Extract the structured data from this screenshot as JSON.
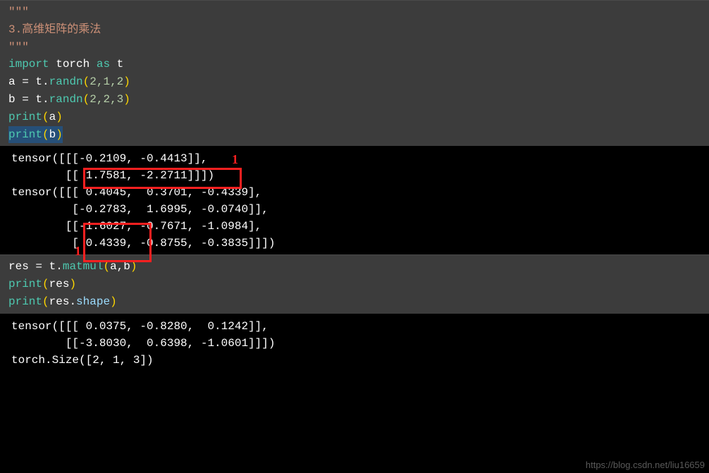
{
  "cell1": {
    "docstring_open": "\"\"\"",
    "comment": "3.高维矩阵的乘法",
    "docstring_close": "\"\"\"",
    "import_kw": "import",
    "import_module": "torch",
    "as_kw": "as",
    "import_alias": "t",
    "line5_var": "a",
    "line5_eq": " = ",
    "line5_obj": "t",
    "line5_dot": ".",
    "line5_fn": "randn",
    "line5_open": "(",
    "line5_args": "2,1,2",
    "line5_close": ")",
    "line6_var": "b",
    "line6_eq": " = ",
    "line6_obj": "t",
    "line6_dot": ".",
    "line6_fn": "randn",
    "line6_open": "(",
    "line6_args": "2,2,3",
    "line6_close": ")",
    "line7_fn": "print",
    "line7_open": "(",
    "line7_arg": "a",
    "line7_close": ")",
    "line8_fn": "print",
    "line8_open": "(",
    "line8_arg": "b",
    "line8_close": ")"
  },
  "output1": {
    "l1": "tensor([[[-0.2109, -0.4413]],",
    "l2": "",
    "l3": "        [[ 1.7581, -2.2711]]])",
    "l4": "tensor([[[ 0.4045,  0.3701, -0.4339],",
    "l5": "         [-0.2783,  1.6995, -0.0740]],",
    "l6": "",
    "l7": "        [[-1.6027, -0.7671, -1.0984],",
    "l8": "         [ 0.4339, -0.8755, -0.3835]]])"
  },
  "cell2": {
    "line1_var": "res",
    "line1_eq": " = ",
    "line1_obj": "t",
    "line1_dot": ".",
    "line1_fn": "matmul",
    "line1_open": "(",
    "line1_arg1": "a",
    "line1_comma": ",",
    "line1_arg2": "b",
    "line1_close": ")",
    "line2_fn": "print",
    "line2_open": "(",
    "line2_arg": "res",
    "line2_close": ")",
    "line3_fn": "print",
    "line3_open": "(",
    "line3_arg": "res",
    "line3_dot": ".",
    "line3_attr": "shape",
    "line3_close": ")"
  },
  "output2": {
    "l1": "tensor([[[ 0.0375, -0.8280,  0.1242]],",
    "l2": "",
    "l3": "        [[-3.8030,  0.6398, -1.0601]]])",
    "l4": "torch.Size([2, 1, 3])"
  },
  "labels": {
    "red1": "1",
    "red2": "1"
  },
  "watermark": "https://blog.csdn.net/liu16659"
}
